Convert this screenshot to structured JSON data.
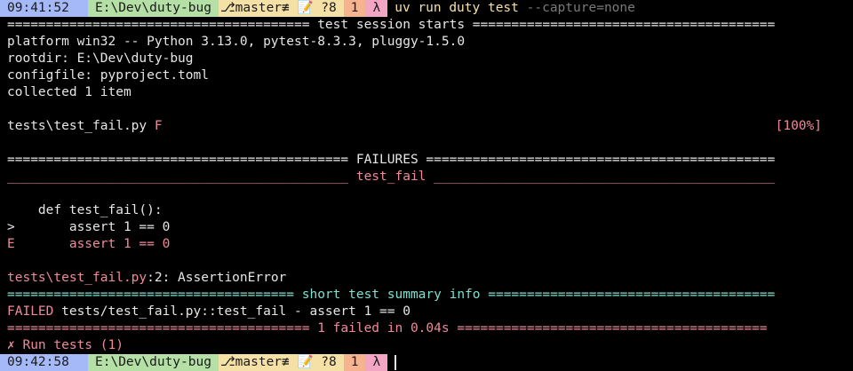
{
  "prompt_top": {
    "time": "09:41:52",
    "dir": "E:\\Dev\\duty-bug",
    "git": "⎇master≢ 📝 ?8",
    "count": "1",
    "lambda": "λ",
    "command": "uv run duty test",
    "command_flag": "--capture=none"
  },
  "session": {
    "header": "======================================= test session starts =======================================",
    "platform": "platform win32 -- Python 3.13.0, pytest-8.3.3, pluggy-1.5.0",
    "rootdir": "rootdir: E:\\Dev\\duty-bug",
    "configfile": "configfile: pyproject.toml",
    "collected": "collected 1 item"
  },
  "progress": {
    "file": "tests\\test_fail.py ",
    "result": "F",
    "percent": "[100%]"
  },
  "failures": {
    "header": "============================================ FAILURES =============================================",
    "test_header": "____________________________________________ test_fail ____________________________________________",
    "code_def": "    def test_fail():",
    "code_marker": ">",
    "code_assert_1": "       assert 1 == 0",
    "error_marker": "E",
    "error_assert": "       assert 1 == 0",
    "location_file": "tests\\test_fail.py",
    "location_rest": ":2: AssertionError"
  },
  "summary": {
    "header": "===================================== short test summary info =====================================",
    "failed_label": "FAILED",
    "failed_text": " tests/test_fail.py::test_fail - assert 1 == 0",
    "result_line": "======================================= 1 failed in 0.04s ========================================",
    "run_tests": "✗ Run tests (1)"
  },
  "prompt_bottom": {
    "time": "09:42:58",
    "dir": "E:\\Dev\\duty-bug",
    "git": "⎇master≢ 📝 ?8",
    "count": "1",
    "lambda": "λ"
  },
  "colors": {
    "background": "#000000",
    "text": "#e6e6e6",
    "error": "#f08a9a",
    "summary": "#7fe0d0",
    "prompt_time": "#a5b8f7",
    "prompt_dir": "#b4e0a6",
    "prompt_git": "#f5e1a6",
    "prompt_count": "#f5b48f",
    "prompt_lambda": "#f3a6c4"
  }
}
